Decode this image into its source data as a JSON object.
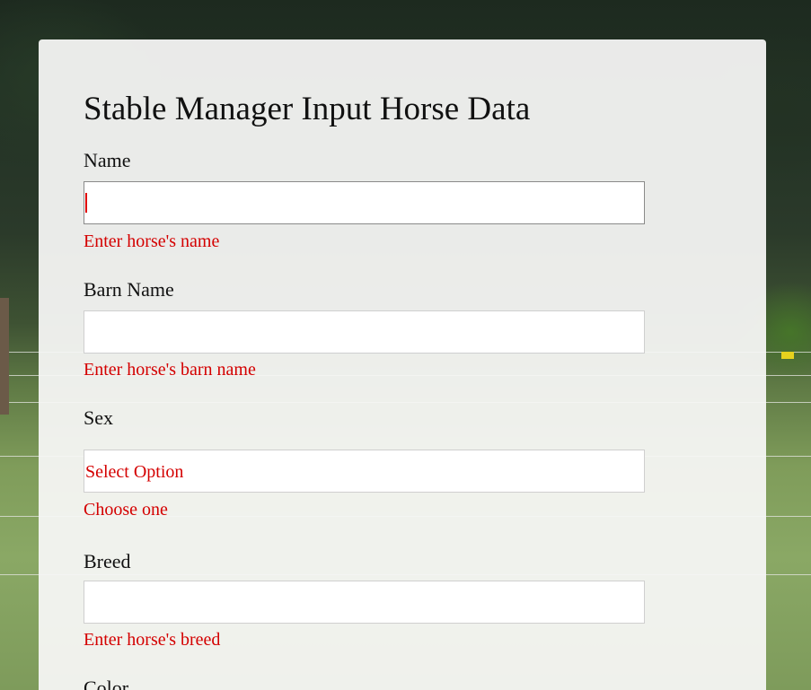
{
  "form": {
    "title": "Stable Manager Input Horse Data",
    "fields": {
      "name": {
        "label": "Name",
        "value": "",
        "error": "Enter horse's name"
      },
      "barn_name": {
        "label": "Barn Name",
        "value": "",
        "error": "Enter horse's barn name"
      },
      "sex": {
        "label": "Sex",
        "selected": "Select Option",
        "error": "Choose one"
      },
      "breed": {
        "label": "Breed",
        "value": "",
        "error": "Enter horse's breed"
      },
      "color": {
        "label": "Color"
      }
    }
  },
  "colors": {
    "error": "#d40000",
    "card_background": "#f7f7f5"
  }
}
